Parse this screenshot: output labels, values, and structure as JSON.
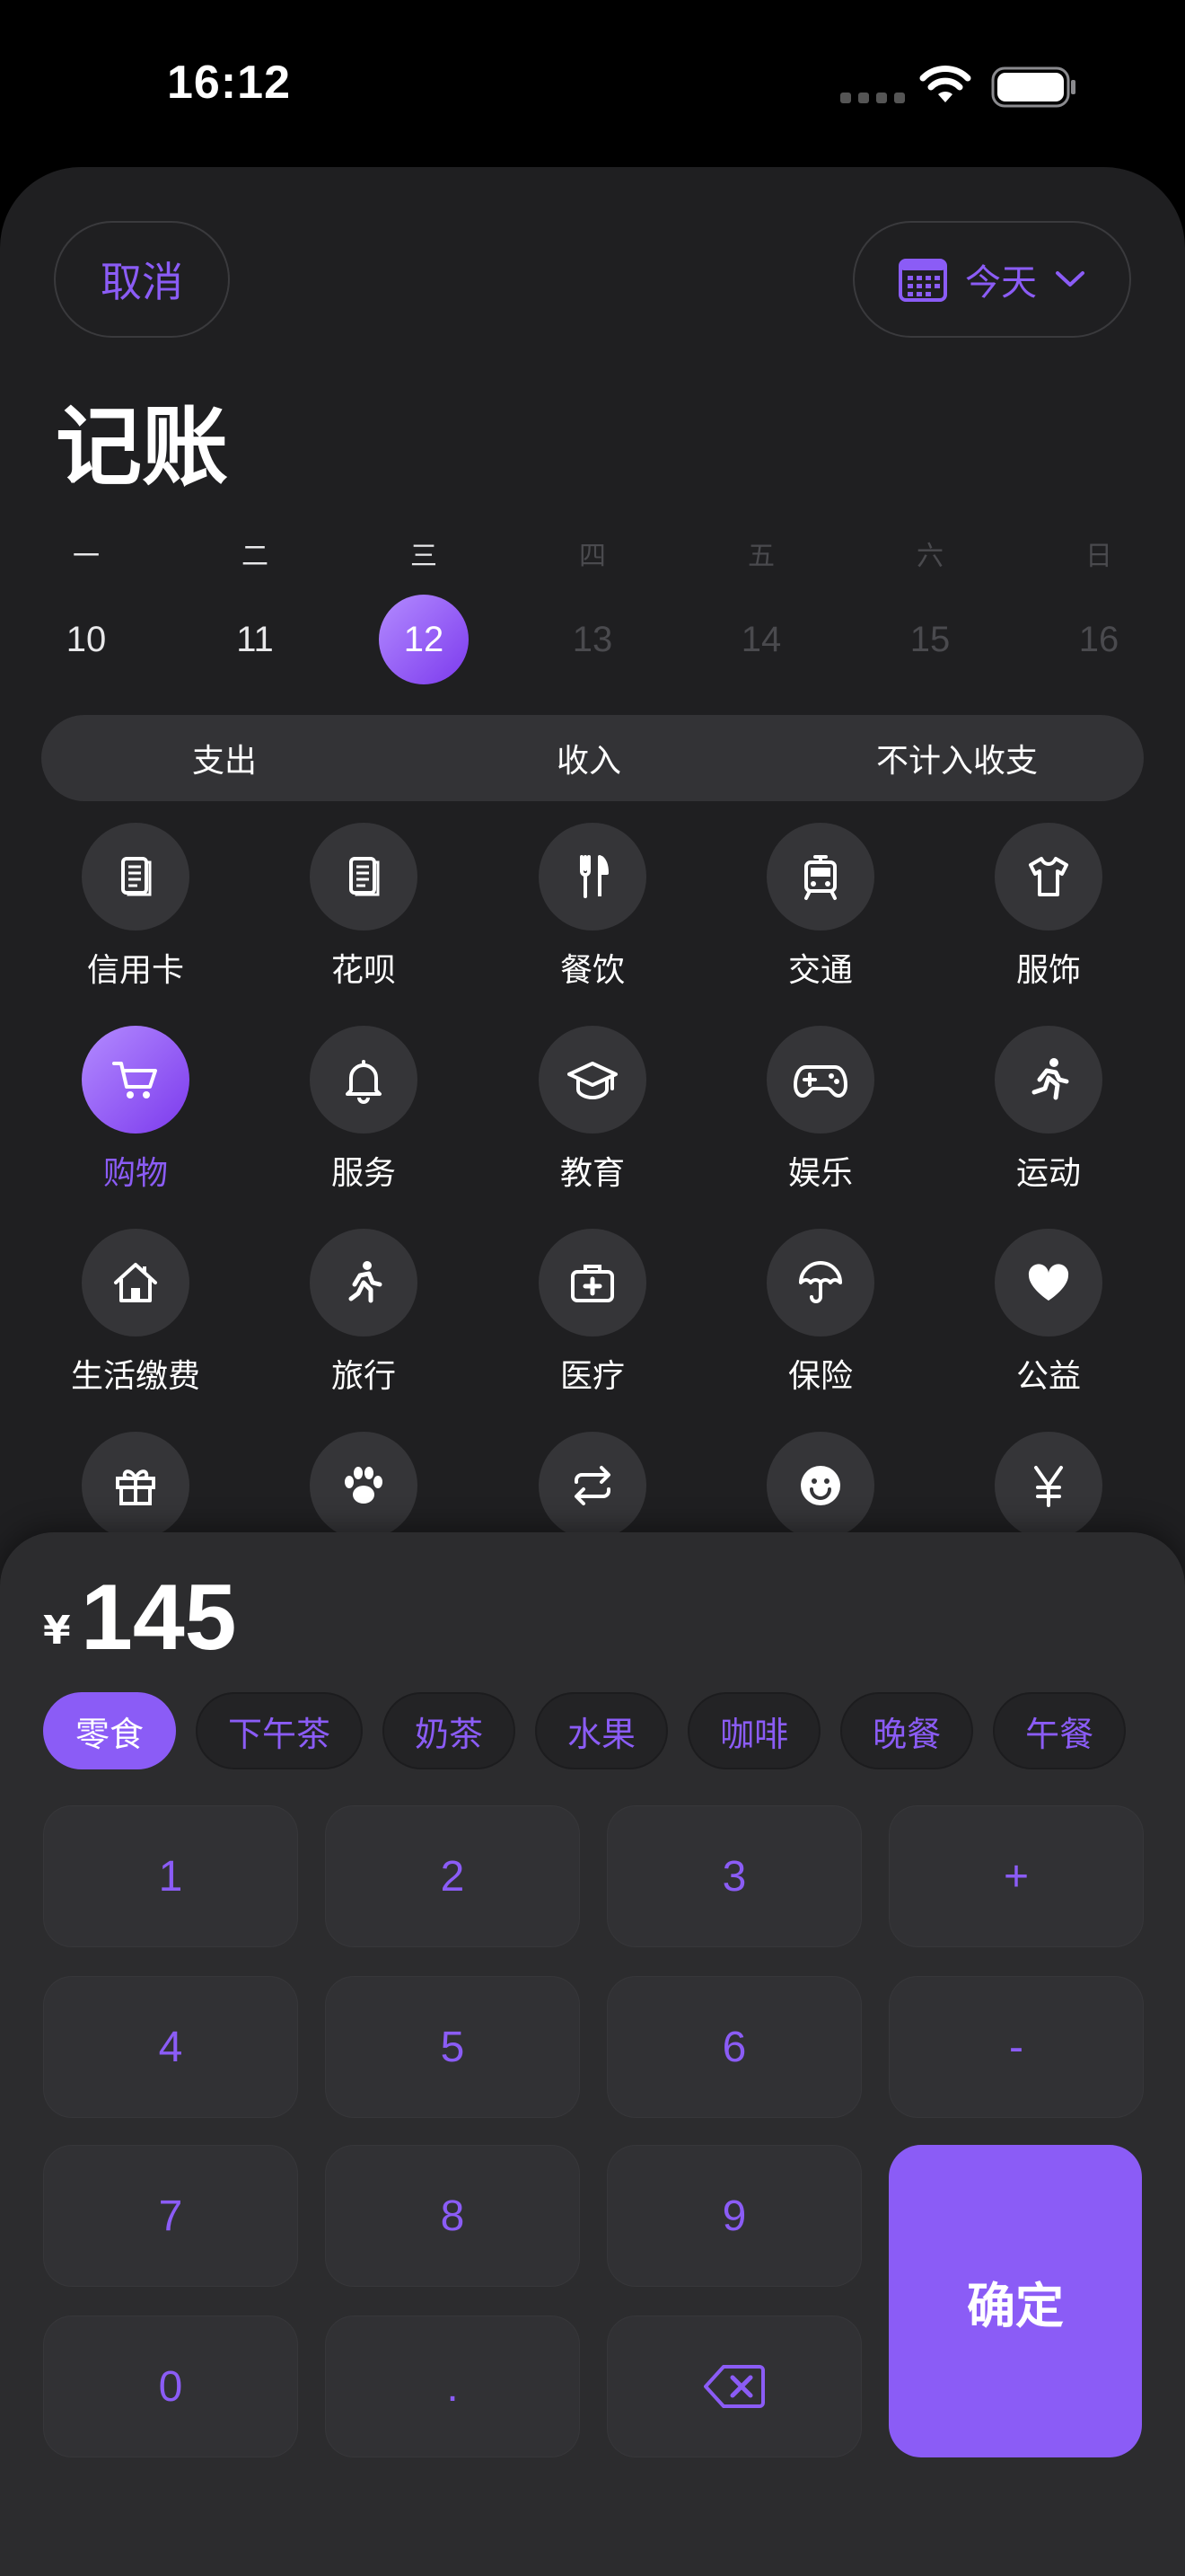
{
  "status": {
    "time": "16:12"
  },
  "header": {
    "cancel": "取消",
    "date_label": "今天",
    "title": "记账"
  },
  "week": [
    {
      "weekday": "一",
      "day": "10",
      "state": "past"
    },
    {
      "weekday": "二",
      "day": "11",
      "state": "past"
    },
    {
      "weekday": "三",
      "day": "12",
      "state": "selected"
    },
    {
      "weekday": "四",
      "day": "13",
      "state": "future"
    },
    {
      "weekday": "五",
      "day": "14",
      "state": "future"
    },
    {
      "weekday": "六",
      "day": "15",
      "state": "future"
    },
    {
      "weekday": "日",
      "day": "16",
      "state": "future"
    }
  ],
  "segments": [
    {
      "label": "支出",
      "active": true
    },
    {
      "label": "收入",
      "active": false
    },
    {
      "label": "不计入收支",
      "active": false
    }
  ],
  "categories": [
    {
      "label": "信用卡",
      "icon": "credit-card-icon"
    },
    {
      "label": "花呗",
      "icon": "bill-icon"
    },
    {
      "label": "餐饮",
      "icon": "fork-knife-icon"
    },
    {
      "label": "交通",
      "icon": "tram-icon"
    },
    {
      "label": "服饰",
      "icon": "tshirt-icon"
    },
    {
      "label": "购物",
      "icon": "cart-icon",
      "active": true
    },
    {
      "label": "服务",
      "icon": "bell-icon"
    },
    {
      "label": "教育",
      "icon": "graduation-cap-icon"
    },
    {
      "label": "娱乐",
      "icon": "gamepad-icon"
    },
    {
      "label": "运动",
      "icon": "running-icon"
    },
    {
      "label": "生活缴费",
      "icon": "house-icon"
    },
    {
      "label": "旅行",
      "icon": "walking-icon"
    },
    {
      "label": "医疗",
      "icon": "medkit-icon"
    },
    {
      "label": "保险",
      "icon": "umbrella-icon"
    },
    {
      "label": "公益",
      "icon": "heart-icon"
    },
    {
      "label": "",
      "icon": "gift-icon"
    },
    {
      "label": "",
      "icon": "paw-icon"
    },
    {
      "label": "",
      "icon": "transfer-icon"
    },
    {
      "label": "",
      "icon": "smile-icon"
    },
    {
      "label": "",
      "icon": "yen-icon"
    }
  ],
  "amount": {
    "currency": "¥",
    "value": "145"
  },
  "tags": [
    "零食",
    "下午茶",
    "奶茶",
    "水果",
    "咖啡",
    "晚餐",
    "午餐"
  ],
  "keypad": {
    "keys": [
      "1",
      "2",
      "3",
      "+",
      "4",
      "5",
      "6",
      "-",
      "7",
      "8",
      "9",
      "0",
      "."
    ],
    "confirm": "确定",
    "backspace_icon": "backspace-icon"
  },
  "colors": {
    "accent": "#8b5cf6",
    "sheet": "#1f1f21",
    "panel": "#2c2c2e"
  }
}
